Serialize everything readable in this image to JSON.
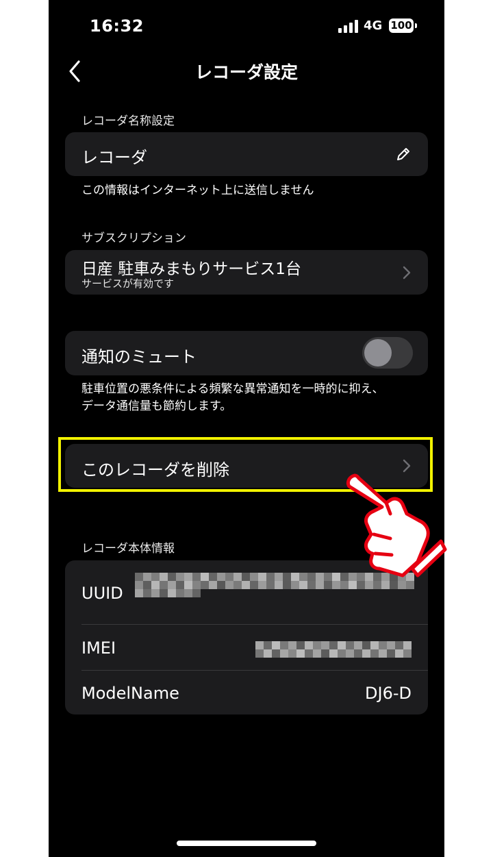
{
  "status_bar": {
    "time": "16:32",
    "network": "4G",
    "battery": "100"
  },
  "header": {
    "title": "レコーダ設定"
  },
  "name_section": {
    "label": "レコーダ名称設定",
    "value": "レコーダ",
    "note": "この情報はインターネット上に送信しません"
  },
  "subscription": {
    "label": "サブスクリプション",
    "title": "日産 駐車みまもりサービス1台",
    "subtitle": "サービスが有効です"
  },
  "mute": {
    "label": "通知のミュート",
    "enabled": false,
    "note_line1": "駐車位置の悪条件による頻繁な異常通知を一時的に抑え、",
    "note_line2": "データ通信量も節約します。"
  },
  "delete": {
    "label": "このレコーダを削除"
  },
  "device_info": {
    "label": "レコーダ本体情報",
    "rows": [
      {
        "key": "UUID",
        "value": ""
      },
      {
        "key": "IMEI",
        "value": ""
      },
      {
        "key": "ModelName",
        "value": "DJ6-D"
      }
    ]
  },
  "icons": {
    "back": "chevron-left-icon",
    "edit": "pencil-icon",
    "chevron": "chevron-right-icon",
    "pointer": "pointing-hand-icon"
  },
  "colors": {
    "background": "#000000",
    "card": "#1c1c1e",
    "highlight": "#f2f200",
    "hand_outline": "#e60012"
  }
}
